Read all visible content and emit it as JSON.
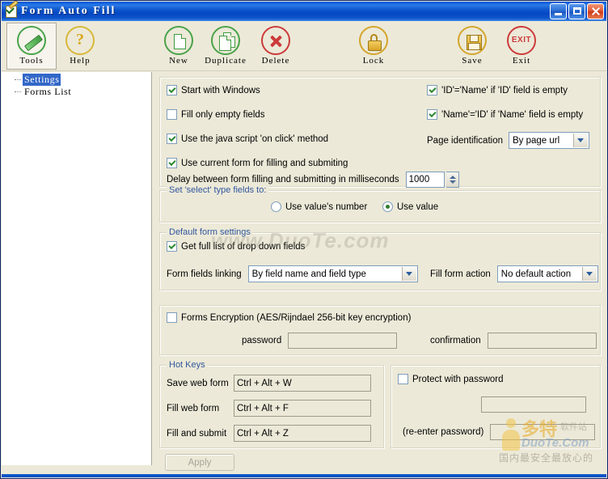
{
  "window": {
    "title": "Form Auto Fill",
    "icon": "form-checkmark-icon",
    "minimize_label": "Minimize",
    "maximize_label": "Maximize",
    "close_label": "Close"
  },
  "toolbar": {
    "buttons": [
      {
        "label": "Tools",
        "icon": "pencil-icon",
        "active": true
      },
      {
        "label": "Help",
        "icon": "question-icon",
        "active": false
      },
      {
        "label": "New",
        "icon": "page-icon",
        "active": false
      },
      {
        "label": "Duplicate",
        "icon": "copy-icon",
        "active": false
      },
      {
        "label": "Delete",
        "icon": "x-circle-icon",
        "active": false
      },
      {
        "label": "Lock",
        "icon": "lock-icon",
        "active": false
      },
      {
        "label": "Save",
        "icon": "diskette-icon",
        "active": false
      },
      {
        "label": "Exit",
        "icon": "exit-icon",
        "active": false
      }
    ]
  },
  "sidebar": {
    "items": [
      {
        "label": "Settings",
        "selected": true
      },
      {
        "label": "Forms List",
        "selected": false
      }
    ]
  },
  "general": {
    "checkboxes_left": [
      {
        "label": "Start with Windows",
        "checked": true
      },
      {
        "label": "Fill only empty fields",
        "checked": false
      },
      {
        "label": "Use the java script 'on click' method",
        "checked": true
      },
      {
        "label": "Use current form for filling and submiting",
        "checked": true
      }
    ],
    "checkboxes_right": [
      {
        "label": "'ID'='Name' if 'ID' field is empty",
        "checked": true
      },
      {
        "label": "'Name'='ID' if 'Name' field is empty",
        "checked": true
      }
    ],
    "page_identification_label": "Page identification",
    "page_identification_value": "By page url",
    "delay_label": "Delay between form filling and submitting in milliseconds",
    "delay_value": "1000"
  },
  "select_fields": {
    "caption": "Set 'select' type fields to:",
    "options": [
      {
        "label": "Use value's number",
        "selected": false
      },
      {
        "label": "Use value",
        "selected": true
      }
    ]
  },
  "default_form": {
    "caption": "Default form settings",
    "full_list_label": "Get full list of drop down fields",
    "full_list_checked": true,
    "linking_label": "Form fields linking",
    "linking_value": "By field name and field type",
    "fill_action_label": "Fill form action",
    "fill_action_value": "No default action"
  },
  "encryption": {
    "label": "Forms Encryption (AES/Rijndael 256-bit key encryption)",
    "checked": false,
    "password_label": "password",
    "password_value": "",
    "confirmation_label": "confirmation",
    "confirmation_value": ""
  },
  "hotkeys": {
    "caption": "Hot Keys",
    "rows": [
      {
        "label": "Save web form",
        "value": "Ctrl + Alt + W"
      },
      {
        "label": "Fill web form",
        "value": "Ctrl + Alt + F"
      },
      {
        "label": "Fill and submit",
        "value": "Ctrl + Alt + Z"
      }
    ]
  },
  "protect": {
    "label": "Protect with password",
    "checked": false,
    "password_value": "",
    "reenter_label": "(re-enter password)",
    "reenter_value": ""
  },
  "footer": {
    "apply_label": "Apply"
  },
  "watermarks": {
    "center": "www.DuoTe.com",
    "logo_cn": "多特",
    "logo_cn2": "软件站",
    "logo_en": "DuoTe.Com",
    "tagline": "国内最安全最放心的"
  }
}
